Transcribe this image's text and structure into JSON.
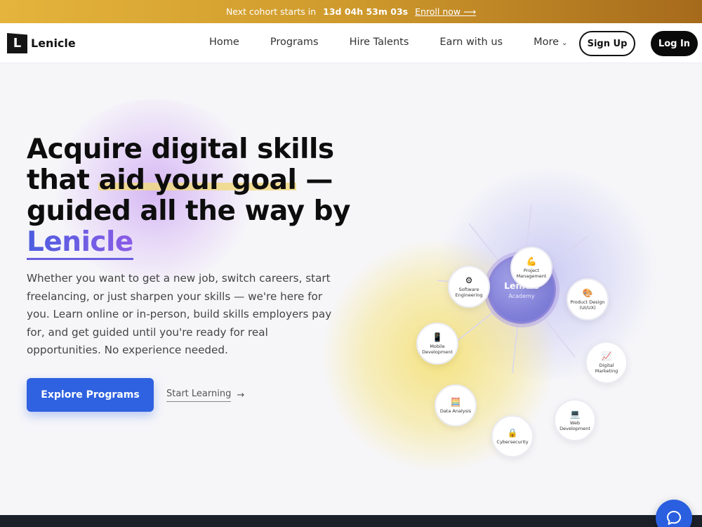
{
  "banner": {
    "prefix": "Next cohort starts in",
    "countdown": "13d 04h 53m 03s",
    "link": "Enroll now ⟶"
  },
  "nav": {
    "logo_text": "Lenicle",
    "links": [
      "Home",
      "Programs",
      "Hire Talents",
      "Earn with us",
      "More"
    ],
    "signup": "Sign Up",
    "login": "Log In"
  },
  "hero": {
    "headline": {
      "line1": "Acquire digital skills",
      "line2_start": "that ",
      "line2_highlight": "aid your goal",
      "line2_end": " —",
      "line3": "guided all the way by",
      "brand": "Lenicle"
    },
    "subtext": "Whether you want to get a new job, switch careers, start freelancing, or just sharpen your skills — we're here for you. Learn online or in-person, build skills employers pay for, and get guided until you're ready for real opportunities. No experience needed.",
    "primary_cta": "Explore Programs",
    "secondary_cta": "Start Learning"
  },
  "network": {
    "center_title": "Lenicle",
    "center_subtitle": "Academy",
    "nodes": [
      {
        "label": "Software Engineering",
        "icon": "⚙"
      },
      {
        "label": "Project Management",
        "icon": "💪"
      },
      {
        "label": "Product Design (UI/UX)",
        "icon": "🎨"
      },
      {
        "label": "Mobile Development",
        "icon": "📱"
      },
      {
        "label": "Digital Marketing",
        "icon": "📈"
      },
      {
        "label": "Data Analysis",
        "icon": "🧮"
      },
      {
        "label": "Web Development",
        "icon": "💻"
      },
      {
        "label": "Cybersecurity",
        "icon": "🔒"
      }
    ]
  },
  "colors": {
    "primary": "#2f62e0",
    "banner_gold": "#cf9a2c",
    "brand_purple": "#7c7bd6"
  }
}
